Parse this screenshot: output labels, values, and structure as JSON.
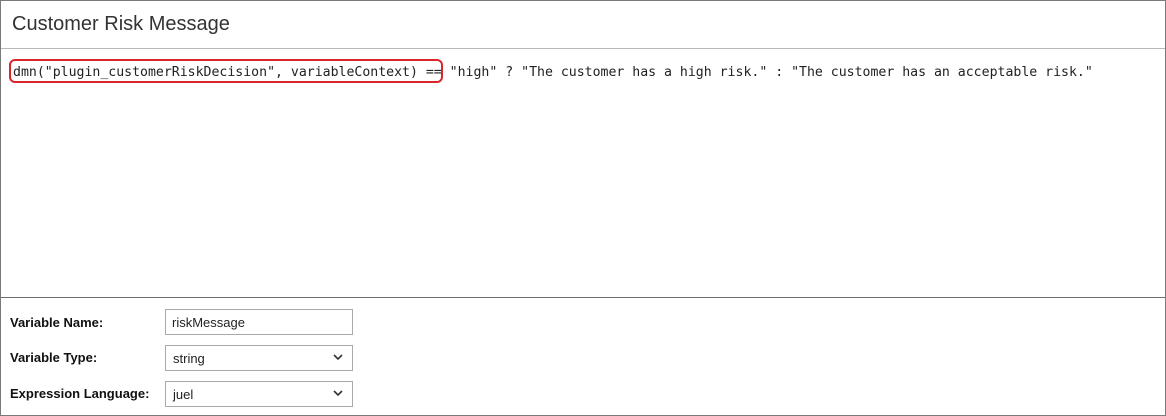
{
  "panel": {
    "title": "Customer Risk Message"
  },
  "editor": {
    "expression": "dmn(\"plugin_customerRiskDecision\", variableContext) == \"high\" ? \"The customer has a high risk.\" : \"The customer has an acceptable risk.\"",
    "highlight_color": "#d9262c"
  },
  "properties": {
    "variable_name": {
      "label": "Variable Name:",
      "value": "riskMessage"
    },
    "variable_type": {
      "label": "Variable Type:",
      "value": "string",
      "icon": "chevron-down-icon"
    },
    "expression_language": {
      "label": "Expression Language:",
      "value": "juel",
      "icon": "chevron-down-icon"
    }
  }
}
